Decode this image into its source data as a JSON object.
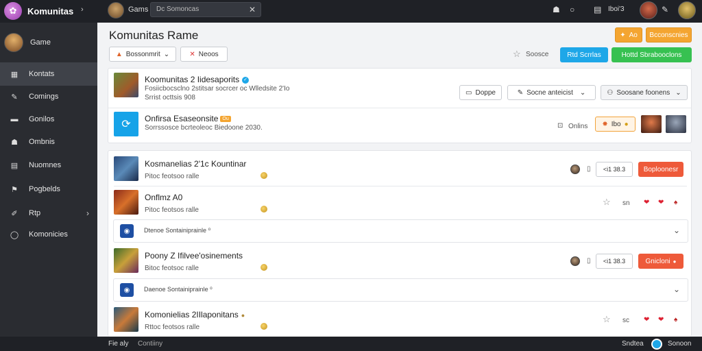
{
  "app": {
    "title": "Komunitas",
    "game_label": "Gams"
  },
  "search": {
    "value": "Dc Somoncas"
  },
  "topbar": {
    "user_label": "Iboi'3"
  },
  "sidebar": {
    "profile_name": "Game",
    "items": [
      {
        "label": "Kontats",
        "icon": "grid-icon",
        "glyph": "▦",
        "active": true
      },
      {
        "label": "Comings",
        "icon": "pen-icon",
        "glyph": "✎"
      },
      {
        "label": "Gonilos",
        "icon": "card-icon",
        "glyph": "▬"
      },
      {
        "label": "Ombnis",
        "icon": "users-icon",
        "glyph": "☗"
      },
      {
        "label": "Nuomnes",
        "icon": "calendar-icon",
        "glyph": "▤"
      },
      {
        "label": "Pogbelds",
        "icon": "flag-icon",
        "glyph": "⚑"
      },
      {
        "label": "Rtp",
        "icon": "tool-icon",
        "glyph": "✐",
        "chevron": "›"
      },
      {
        "label": "Komonicies",
        "icon": "circle-icon",
        "glyph": "◯"
      }
    ]
  },
  "page": {
    "title": "Komunitas Rame",
    "filter_label": "Bossonmrit",
    "filter_caret": "⌄",
    "close_filter_label": "Neoos",
    "top_right_orange_small": "Ao",
    "top_right_orange": "Bcconscnies",
    "star_label": "Soosce",
    "blue_button": "Rtd Scrrlas",
    "green_button": "Hottd Sbrabooclons"
  },
  "featured": [
    {
      "title": "Koomunitas 2 Iidesaporits",
      "line1": "Fosiicbocsclno 2stitsar socrcer oc Wlledsite 2'Io",
      "line2": "Srrist octtsis 908",
      "btn_a": "Doppe",
      "btn_b": "Socne anteicist",
      "btn_c": "Soosane foonens"
    },
    {
      "title": "Onfirsa Esaseonsite",
      "badge": "Ou",
      "line1": "Sorrssosce bcrteoleoc Biedoone 2030.",
      "online": "Onlins",
      "count": "Ibo"
    }
  ],
  "posts": [
    {
      "title": "Kosmanelias 2'1c Kountinar",
      "sub": "Pitoc feotsoo ralle",
      "count": "<i1 38.3",
      "action": "Boploonesr"
    },
    {
      "title": "Onflmz A0",
      "sub": "Pitoc feotsos ralle",
      "score": "sn"
    },
    {
      "sub_text": "Dtenoe Sontainiprainle ⁰"
    },
    {
      "title": "Poony Z Ifilvee'osinements",
      "sub": "Bitoc feotsoc ralle",
      "count": "<i1 38.3",
      "action": "Gnicloni"
    },
    {
      "sub_text": "Daenoe Sontainiprainle ⁰"
    },
    {
      "title": "Komonielias 2IIlaponitans",
      "sub": "Rttoc feotsos ralle",
      "score": "sc"
    }
  ],
  "footer": {
    "left": "Fie aly",
    "left2": "Contiiny",
    "right": "Sndtea",
    "right2": "Sonoon"
  }
}
